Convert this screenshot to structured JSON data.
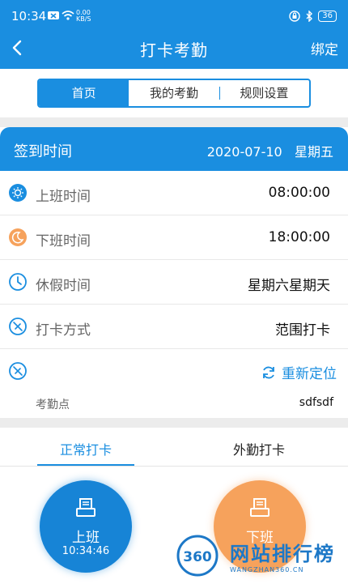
{
  "status_bar": {
    "time": "10:34",
    "net_speed_value": "0.00",
    "net_speed_unit": "KB/S",
    "battery": "36"
  },
  "header": {
    "title": "打卡考勤",
    "bind_label": "绑定"
  },
  "segments": [
    {
      "label": "首页",
      "active": true
    },
    {
      "label": "我的考勤",
      "active": false
    },
    {
      "label": "规则设置",
      "active": false
    }
  ],
  "sign_card": {
    "label": "签到时间",
    "date": "2020-07-10",
    "weekday": "星期五",
    "rows": [
      {
        "label": "上班时间",
        "value": "08:00:00",
        "icon": "sun-icon"
      },
      {
        "label": "下班时间",
        "value": "18:00:00",
        "icon": "moon-icon"
      },
      {
        "label": "休假时间",
        "value": "星期六星期天",
        "icon": "clock-icon"
      },
      {
        "label": "打卡方式",
        "value": "范围打卡",
        "icon": "compass-icon"
      }
    ],
    "relocate_label": "重新定位",
    "point_label": "考勤点",
    "point_value": "sdfsdf"
  },
  "tabs": [
    {
      "label": "正常打卡",
      "active": true
    },
    {
      "label": "外勤打卡",
      "active": false
    }
  ],
  "punch": {
    "on": {
      "label": "上班",
      "time": "10:34:46"
    },
    "off": {
      "label": "下班"
    }
  },
  "watermark": {
    "brand": "网站排行榜",
    "logo_text": "360",
    "sub": "WANGZHAN360.CN"
  },
  "colors": {
    "primary": "#1a8ee0",
    "orange": "#f6a25c",
    "background": "#ececec"
  }
}
